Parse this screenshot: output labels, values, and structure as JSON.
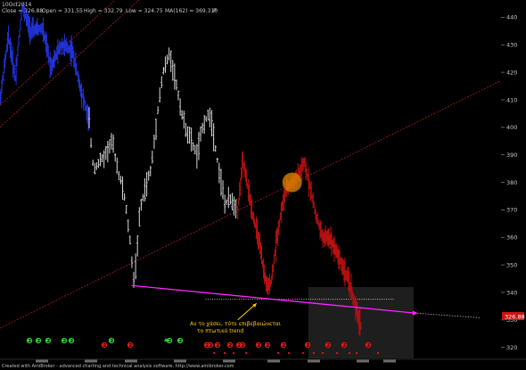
{
  "header": {
    "date": "10Oct2014",
    "close_label": "Close = 326.88",
    "open_label": "Open = 331.55",
    "high_label": "High = 332.79",
    "low_label": "Low = 324.75",
    "ma_label": "MA(162) = 369.310",
    "p_label": "P"
  },
  "last_price_tag": "326.88",
  "annotation": {
    "line1": "Αν το χάσει, τότε επιβεβαιώνεται",
    "line2": "το πτωτικό trend"
  },
  "credit": "Created with AmiBroker - advanced charting and technical analysis software. http://www.amibroker.com",
  "colors": {
    "background": "#000000",
    "uptrend_bars": "#2233dd",
    "neutral_bars": "#d8d8d8",
    "downtrend_bars": "#bb1111",
    "support_line": "#ff22ff",
    "channel_lines": "#aa1f1f",
    "arrow": "#ffcc00",
    "highlight_circle": "#e08a00"
  },
  "chart_data": {
    "type": "ohlc",
    "y_axis": {
      "side": "right",
      "range": [
        316,
        445
      ],
      "ticks": [
        320,
        330,
        340,
        350,
        360,
        370,
        380,
        390,
        400,
        410,
        420,
        430,
        440
      ]
    },
    "segments": [
      {
        "trend": "up",
        "color": "blue",
        "bars": 105,
        "path": [
          [
            0,
            410
          ],
          [
            10,
            433
          ],
          [
            18,
            418
          ],
          [
            26,
            444
          ],
          [
            36,
            435
          ],
          [
            50,
            436
          ],
          [
            60,
            422
          ],
          [
            72,
            430
          ],
          [
            85,
            428
          ],
          [
            95,
            414
          ],
          [
            105,
            402
          ]
        ]
      },
      {
        "trend": "neutral",
        "color": "gray",
        "bars": 80,
        "path": [
          [
            105,
            402
          ],
          [
            110,
            385
          ],
          [
            122,
            389
          ],
          [
            132,
            395
          ],
          [
            140,
            383
          ],
          [
            146,
            376
          ],
          [
            152,
            362
          ],
          [
            158,
            343
          ],
          [
            165,
            370
          ],
          [
            172,
            379
          ],
          [
            178,
            385
          ],
          [
            186,
            407
          ],
          [
            192,
            420
          ],
          [
            200,
            427
          ],
          [
            208,
            415
          ],
          [
            216,
            402
          ],
          [
            225,
            395
          ],
          [
            232,
            390
          ],
          [
            240,
            402
          ],
          [
            248,
            405
          ],
          [
            256,
            388
          ],
          [
            265,
            372
          ],
          [
            272,
            374
          ],
          [
            280,
            370
          ]
        ]
      },
      {
        "trend": "down",
        "color": "red",
        "bars": 140,
        "path": [
          [
            280,
            370
          ],
          [
            286,
            388
          ],
          [
            292,
            378
          ],
          [
            298,
            368
          ],
          [
            304,
            360
          ],
          [
            310,
            349
          ],
          [
            315,
            341
          ],
          [
            320,
            345
          ],
          [
            326,
            360
          ],
          [
            332,
            371
          ],
          [
            338,
            378
          ],
          [
            344,
            380
          ],
          [
            352,
            383
          ],
          [
            358,
            387
          ],
          [
            364,
            380
          ],
          [
            372,
            368
          ],
          [
            380,
            360
          ],
          [
            388,
            360
          ],
          [
            396,
            355
          ],
          [
            404,
            349
          ],
          [
            412,
            343
          ],
          [
            420,
            333
          ],
          [
            426,
            327
          ]
        ]
      }
    ],
    "support_line": {
      "from": [
        155,
        342.5
      ],
      "to": [
        488,
        332.5
      ],
      "extension_to": [
        565,
        330.8
      ]
    },
    "horizontal_level": 337.5,
    "channel_lines": [
      {
        "from": [
          0,
          400
        ],
        "to": [
          590,
          567
        ]
      },
      {
        "from": [
          0,
          408
        ],
        "to": [
          590,
          575
        ]
      },
      {
        "from": [
          0,
          327
        ],
        "to": [
          590,
          417
        ]
      }
    ],
    "highlight_circle": {
      "at": [
        344,
        380
      ]
    },
    "callout_arrow": {
      "from": [
        280,
        330
      ],
      "to": [
        302,
        336
      ]
    },
    "last_price": 326.88,
    "signal_markers": [
      {
        "label": "2",
        "color": "green"
      },
      {
        "label": "2",
        "color": "green"
      },
      {
        "label": "2",
        "color": "green"
      },
      {
        "label": "2",
        "color": "green"
      },
      {
        "label": "2",
        "color": "green"
      },
      {
        "label": "2",
        "color": "green"
      },
      {
        "label": "2",
        "color": "green"
      },
      {
        "label": "2",
        "color": "green"
      },
      {
        "label": "2",
        "color": "red"
      },
      {
        "label": "2",
        "color": "red"
      },
      {
        "label": "2",
        "color": "red"
      },
      {
        "label": "2",
        "color": "red"
      },
      {
        "label": "2",
        "color": "red"
      },
      {
        "label": "2",
        "color": "red"
      },
      {
        "label": "2",
        "color": "red"
      },
      {
        "label": "2",
        "color": "red"
      },
      {
        "label": "2",
        "color": "red"
      },
      {
        "label": "2",
        "color": "red"
      },
      {
        "label": "2",
        "color": "red"
      },
      {
        "label": "2",
        "color": "red"
      },
      {
        "label": "2",
        "color": "red"
      },
      {
        "label": "2",
        "color": "red"
      },
      {
        "label": "2",
        "color": "red"
      }
    ]
  }
}
